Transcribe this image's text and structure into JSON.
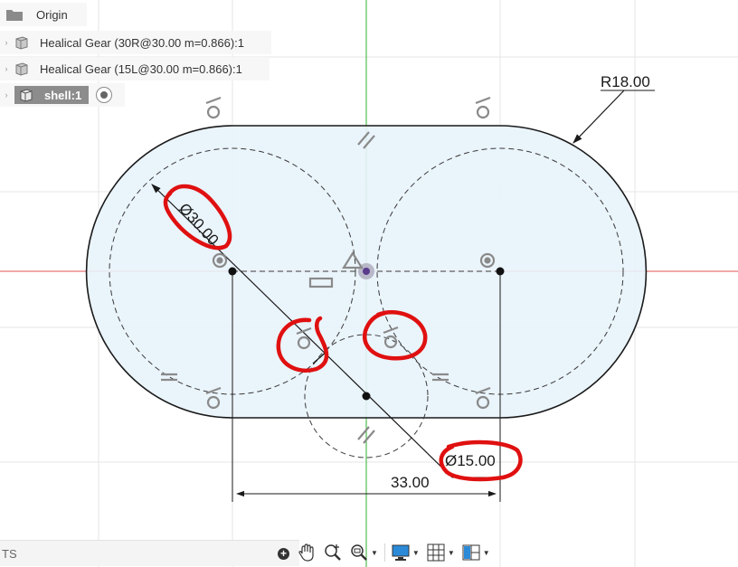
{
  "browser": {
    "origin_label": "Origin",
    "bodies": [
      {
        "label": "Healical Gear (30R@30.00 m=0.866):1"
      },
      {
        "label": "Healical Gear (15L@30.00 m=0.866):1"
      }
    ],
    "active_component_label": "shell:1"
  },
  "dimensions": {
    "radius": "R18.00",
    "diameter_large": "Ø30.00",
    "diameter_small": "Ø15.00",
    "distance": "33.00"
  },
  "status_bar": {
    "text": "TS"
  },
  "toolbar": {
    "icons": [
      "pan-icon",
      "zoom-icon",
      "zoom-window-icon",
      "display-settings-icon",
      "grid-settings-icon",
      "viewports-icon"
    ]
  },
  "colors": {
    "profile_fill": "#e8f3fb",
    "sketch_line": "#1a1a1a",
    "x_axis": "#e05050",
    "y_axis": "#2fb02f",
    "annotation": "#e01010",
    "grid": "#e6e6e6"
  }
}
